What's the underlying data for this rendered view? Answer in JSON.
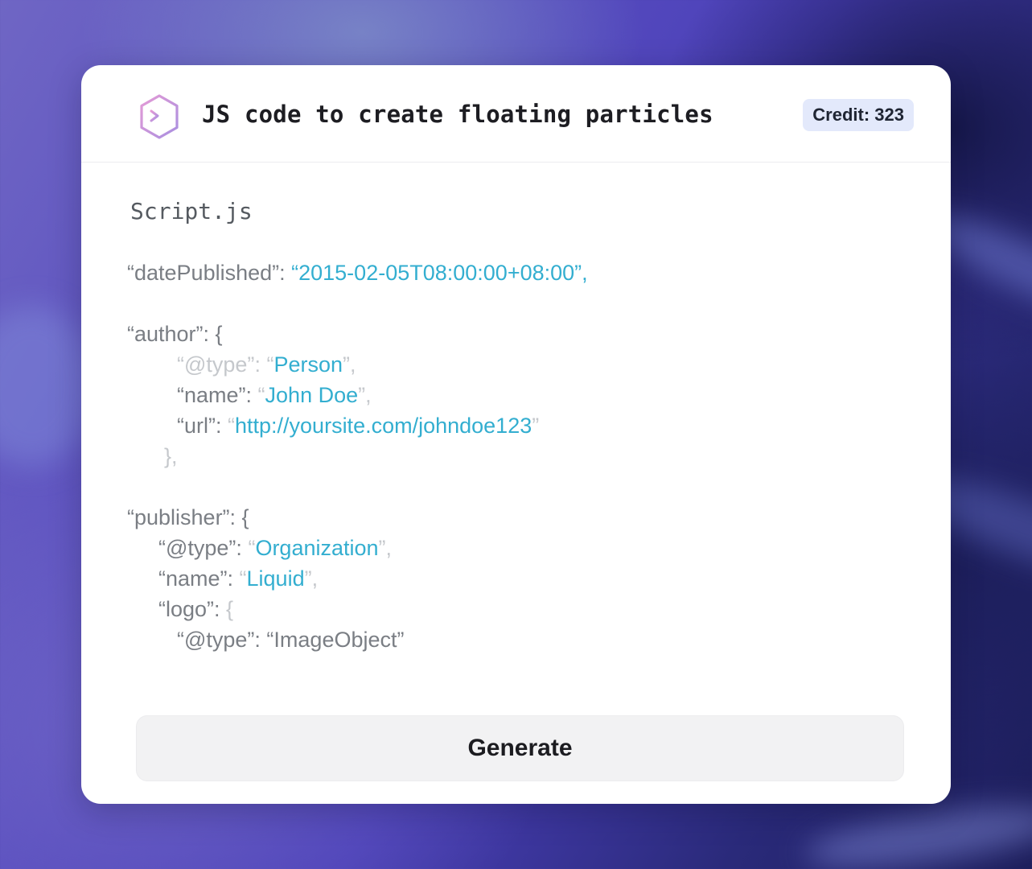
{
  "header": {
    "title": "JS code to create floating particles",
    "credit": "Credit: 323",
    "logo_icon": "terminal-hexagon-icon"
  },
  "editor": {
    "file_name": "Script.js",
    "lines": {
      "date_key": "“datePublished”: ",
      "date_val": "“2015-02-05T08:00:00+08:00”,",
      "author_key": "“author”: {",
      "author_type_key": "“@type”",
      "author_type_sep": ": “",
      "author_type_val": "Person",
      "author_type_end": "”,",
      "author_name_key": "“name”: ",
      "author_name_open": "“",
      "author_name_val": "John Doe",
      "author_name_end": "”,",
      "author_url_key": "“url”: ",
      "author_url_open": "“",
      "author_url_val": "http://yoursite.com/johndoe123",
      "author_url_end": "”",
      "author_close": "},",
      "publisher_key": "“publisher”: {",
      "pub_type_key": "“@type”: ",
      "pub_type_open": "“",
      "pub_type_val": "Organization",
      "pub_type_end": "”,",
      "pub_name_key": "“name”: ",
      "pub_name_open": "“",
      "pub_name_val": "Liquid",
      "pub_name_end": "”,",
      "logo_key": "“logo”: ",
      "logo_open": "{",
      "logo_type": "“@type”: “ImageObject”"
    }
  },
  "actions": {
    "generate_label": "Generate"
  },
  "colors": {
    "value": "#33aed0",
    "key": "#7a7e84",
    "credit_bg": "#e3e9fb"
  }
}
